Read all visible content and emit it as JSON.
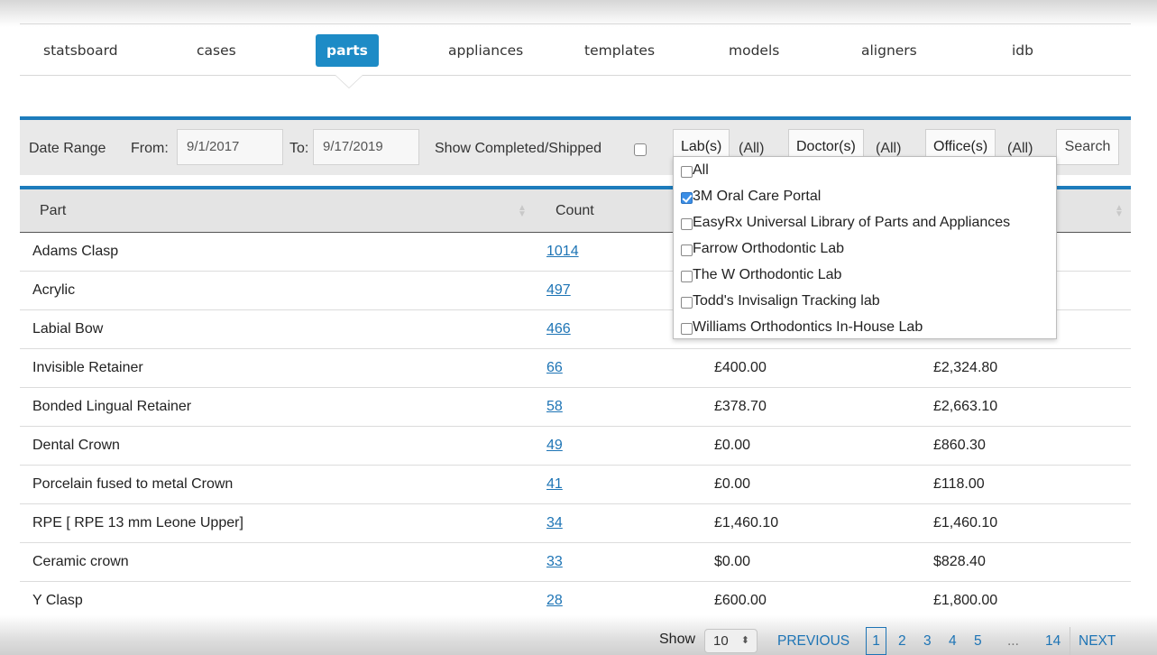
{
  "nav": {
    "tabs": [
      {
        "label": "statsboard"
      },
      {
        "label": "cases"
      },
      {
        "label": "parts",
        "active": true
      },
      {
        "label": "appliances"
      },
      {
        "label": "templates"
      },
      {
        "label": "models"
      },
      {
        "label": "aligners"
      },
      {
        "label": "idb"
      }
    ]
  },
  "filters": {
    "date_range_label": "Date Range",
    "from_label": "From:",
    "from_value": "9/1/2017",
    "to_label": "To:",
    "to_value": "9/17/2019",
    "show_completed_label": "Show Completed/Shipped",
    "show_completed_checked": false,
    "lab_button": "Lab(s)",
    "lab_value": "(All)",
    "doctor_button": "Doctor(s)",
    "doctor_value": "(All)",
    "office_button": "Office(s)",
    "office_value": "(All)",
    "search_label": "Search"
  },
  "lab_dropdown": {
    "items": [
      {
        "label": "All",
        "checked": false
      },
      {
        "label": "3M Oral Care Portal",
        "checked": true
      },
      {
        "label": "EasyRx Universal Library of Parts and Appliances",
        "checked": false
      },
      {
        "label": "Farrow Orthodontic Lab",
        "checked": false
      },
      {
        "label": "The W Orthodontic Lab",
        "checked": false
      },
      {
        "label": "Todd's Invisalign Tracking lab",
        "checked": false
      },
      {
        "label": "Williams Orthodontics In-House Lab",
        "checked": false
      }
    ]
  },
  "table": {
    "headers": {
      "part": "Part",
      "count": "Count"
    },
    "rows": [
      {
        "part": "Adams Clasp",
        "count": "1014",
        "price": "",
        "total": ""
      },
      {
        "part": "Acrylic",
        "count": "497",
        "price": "",
        "total": ""
      },
      {
        "part": "Labial Bow",
        "count": "466",
        "price": "",
        "total": ""
      },
      {
        "part": "Invisible Retainer",
        "count": "66",
        "price": "£400.00",
        "total": "£2,324.80"
      },
      {
        "part": "Bonded Lingual Retainer",
        "count": "58",
        "price": "£378.70",
        "total": "£2,663.10"
      },
      {
        "part": "Dental Crown",
        "count": "49",
        "price": "£0.00",
        "total": "£860.30"
      },
      {
        "part": "Porcelain fused to metal Crown",
        "count": "41",
        "price": "£0.00",
        "total": "£118.00"
      },
      {
        "part": "RPE [ RPE 13 mm Leone Upper]",
        "count": "34",
        "price": "£1,460.10",
        "total": "£1,460.10"
      },
      {
        "part": "Ceramic crown",
        "count": "33",
        "price": "$0.00",
        "total": "$828.40"
      },
      {
        "part": "Y Clasp",
        "count": "28",
        "price": "£600.00",
        "total": "£1,800.00"
      }
    ]
  },
  "pagination": {
    "show_label": "Show",
    "page_size": "10",
    "previous_label": "PREVIOUS",
    "pages": [
      "1",
      "2",
      "3",
      "4",
      "5"
    ],
    "current_page": "1",
    "ellipsis": "...",
    "last_page": "14",
    "next_label": "NEXT"
  },
  "colors": {
    "accent": "#1d8bc6",
    "link": "#1d74b5",
    "header_bg": "#e4e4e4",
    "filter_bg": "#e9e9e9"
  }
}
